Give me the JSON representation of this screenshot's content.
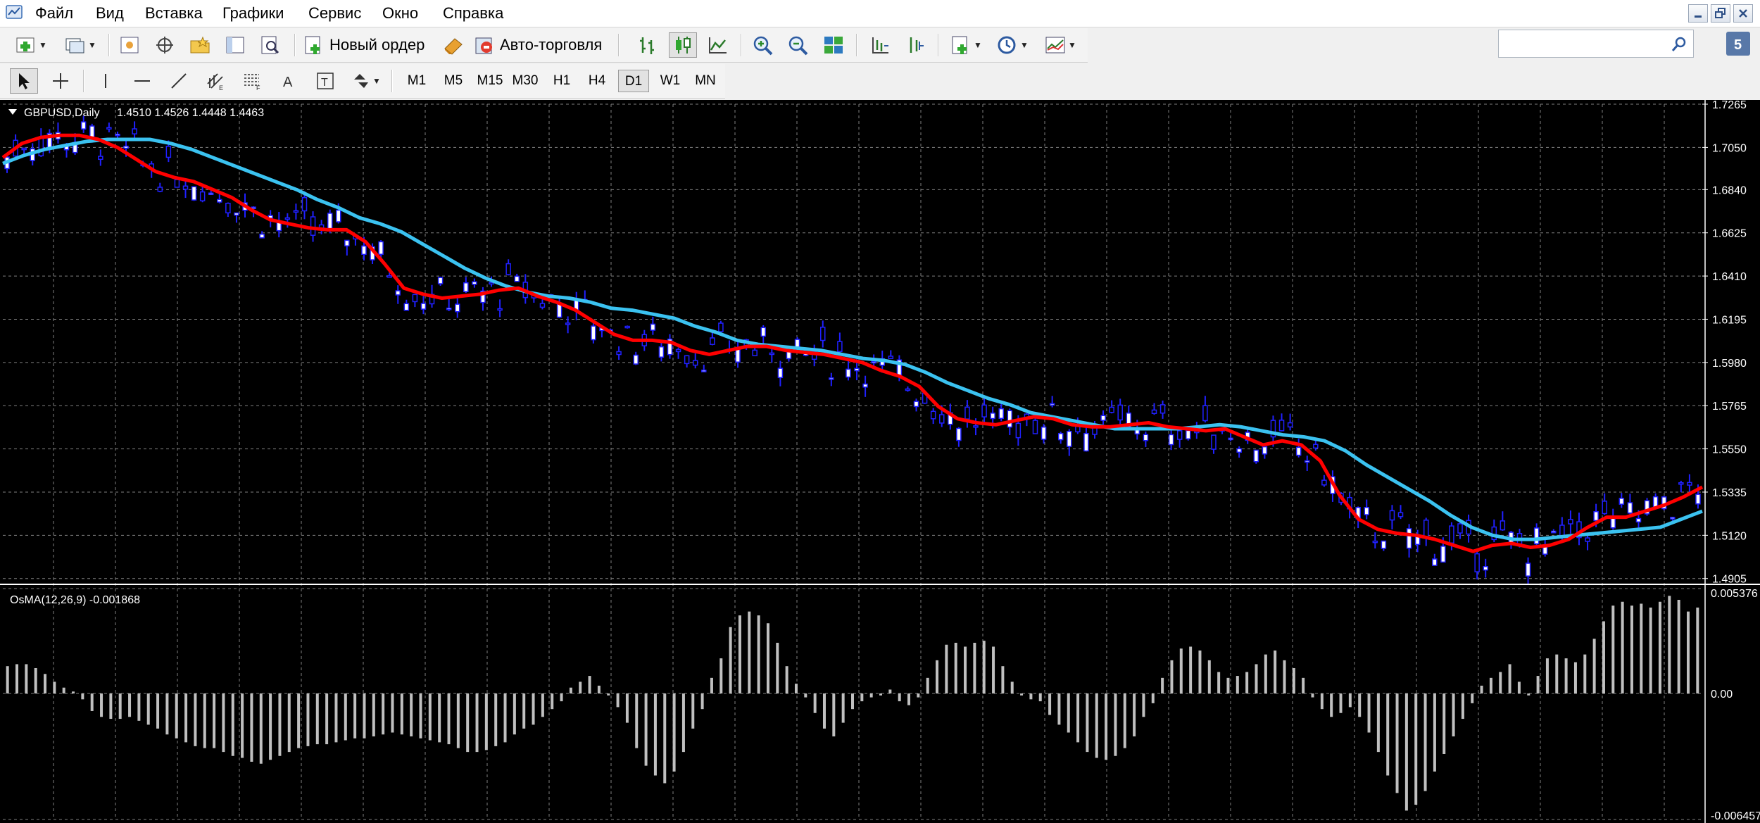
{
  "menu": [
    "Файл",
    "Вид",
    "Вставка",
    "Графики",
    "Сервис",
    "Окно",
    "Справка"
  ],
  "toolbar": {
    "new_order_label": "Новый ордер",
    "auto_trading_label": "Авто-торговля"
  },
  "timeframes": [
    "M1",
    "M5",
    "M15",
    "M30",
    "H1",
    "H4",
    "D1",
    "W1",
    "MN"
  ],
  "active_timeframe": "D1",
  "search": {
    "placeholder": "",
    "value": ""
  },
  "chart_data": [
    {
      "type": "line",
      "symbol": "GBPUSD,Daily",
      "ohlc_label": "1.4510 1.4526 1.4448 1.4463",
      "y_ticks": [
        "1.7265",
        "1.7050",
        "1.6840",
        "1.6625",
        "1.6410",
        "1.6195",
        "1.5980",
        "1.5765",
        "1.5550",
        "1.5335",
        "1.5120",
        "1.4905"
      ],
      "ylim": [
        1.489,
        1.7265
      ],
      "grid": true,
      "bars_shown": 200,
      "series": [
        {
          "color": "#ff0000",
          "values": [
            1.7,
            1.707,
            1.71,
            1.711,
            1.711,
            1.709,
            1.705,
            1.699,
            1.693,
            1.69,
            1.688,
            1.684,
            1.68,
            1.674,
            1.669,
            1.667,
            1.665,
            1.664,
            1.664,
            1.658,
            1.647,
            1.635,
            1.632,
            1.63,
            1.631,
            1.632,
            1.634,
            1.635,
            1.631,
            1.628,
            1.624,
            1.618,
            1.612,
            1.609,
            1.609,
            1.608,
            1.604,
            1.602,
            1.604,
            1.606,
            1.606,
            1.604,
            1.603,
            1.602,
            1.6,
            1.598,
            1.594,
            1.591,
            1.586,
            1.576,
            1.57,
            1.568,
            1.567,
            1.569,
            1.571,
            1.57,
            1.567,
            1.566,
            1.566,
            1.567,
            1.568,
            1.566,
            1.565,
            1.564,
            1.565,
            1.561,
            1.557,
            1.559,
            1.557,
            1.549,
            1.532,
            1.52,
            1.515,
            1.513,
            1.512,
            1.51,
            1.507,
            1.504,
            1.507,
            1.508,
            1.506,
            1.507,
            1.51,
            1.516,
            1.521,
            1.521,
            1.524,
            1.527,
            1.531,
            1.536
          ]
        },
        {
          "color": "#3bc2f0",
          "values": [
            1.697,
            1.701,
            1.704,
            1.706,
            1.708,
            1.709,
            1.709,
            1.709,
            1.707,
            1.704,
            1.7,
            1.696,
            1.692,
            1.688,
            1.684,
            1.679,
            1.675,
            1.67,
            1.667,
            1.663,
            1.657,
            1.651,
            1.645,
            1.64,
            1.636,
            1.633,
            1.631,
            1.63,
            1.628,
            1.625,
            1.624,
            1.622,
            1.62,
            1.616,
            1.613,
            1.609,
            1.607,
            1.606,
            1.605,
            1.604,
            1.602,
            1.6,
            1.599,
            1.597,
            1.593,
            1.588,
            1.584,
            1.58,
            1.577,
            1.573,
            1.571,
            1.569,
            1.567,
            1.565,
            1.565,
            1.565,
            1.565,
            1.566,
            1.567,
            1.566,
            1.564,
            1.562,
            1.561,
            1.559,
            1.554,
            1.547,
            1.541,
            1.535,
            1.529,
            1.522,
            1.516,
            1.512,
            1.51,
            1.51,
            1.511,
            1.512,
            1.513,
            1.514,
            1.515,
            1.516,
            1.52,
            1.524
          ]
        }
      ]
    },
    {
      "type": "bar",
      "title": "OsMA(12,26,9) -0.001868",
      "y_ticks": [
        "0.005376",
        "0.00",
        "-0.006457"
      ],
      "ylim": [
        -0.006457,
        0.005376
      ],
      "grid": true,
      "values": [
        0.0014,
        0.0015,
        0.0015,
        0.0013,
        0.001,
        0.0006,
        0.0003,
        0.0001,
        -0.0003,
        -0.0009,
        -0.0012,
        -0.0013,
        -0.0013,
        -0.0012,
        -0.0014,
        -0.0016,
        -0.0018,
        -0.0021,
        -0.0023,
        -0.0025,
        -0.0027,
        -0.0028,
        -0.0028,
        -0.003,
        -0.0032,
        -0.0033,
        -0.0035,
        -0.0036,
        -0.0034,
        -0.0032,
        -0.003,
        -0.0028,
        -0.0027,
        -0.0026,
        -0.0026,
        -0.0025,
        -0.0024,
        -0.0023,
        -0.0023,
        -0.0022,
        -0.0021,
        -0.002,
        -0.0021,
        -0.0022,
        -0.0023,
        -0.0024,
        -0.0025,
        -0.0026,
        -0.0028,
        -0.003,
        -0.003,
        -0.0029,
        -0.0027,
        -0.0025,
        -0.0021,
        -0.0018,
        -0.0016,
        -0.0012,
        -0.0008,
        -0.0004,
        0.0003,
        0.0006,
        0.0009,
        0.0004,
        -0.0001,
        -0.0007,
        -0.0015,
        -0.0028,
        -0.0037,
        -0.0042,
        -0.0046,
        -0.004,
        -0.003,
        -0.0018,
        -0.0008,
        0.0008,
        0.0018,
        0.0034,
        0.004,
        0.0042,
        0.004,
        0.0036,
        0.0026,
        0.0014,
        0.0005,
        -0.0002,
        -0.001,
        -0.0018,
        -0.0022,
        -0.0015,
        -0.0008,
        -0.0004,
        -0.0002,
        -0.0001,
        0.0002,
        -0.0004,
        -0.0006,
        -0.0002,
        0.0008,
        0.0017,
        0.0025,
        0.0026,
        0.0024,
        0.0026,
        0.0027,
        0.0024,
        0.0014,
        0.0006,
        -0.0001,
        -0.0003,
        -0.0004,
        -0.0011,
        -0.0016,
        -0.002,
        -0.0025,
        -0.003,
        -0.0033,
        -0.0034,
        -0.0032,
        -0.0028,
        -0.0022,
        -0.0012,
        -0.0005,
        0.0008,
        0.0017,
        0.0023,
        0.0024,
        0.0022,
        0.0017,
        0.0011,
        0.0008,
        0.0009,
        0.0011,
        0.0015,
        0.002,
        0.0022,
        0.0017,
        0.0013,
        0.0008,
        -0.0002,
        -0.0008,
        -0.0012,
        -0.001,
        -0.0007,
        -0.0012,
        -0.002,
        -0.003,
        -0.0042,
        -0.0051,
        -0.006,
        -0.0057,
        -0.005,
        -0.004,
        -0.0031,
        -0.0022,
        -0.0013,
        -0.0005,
        0.0004,
        0.0008,
        0.0011,
        0.0015,
        0.0006,
        -0.0001,
        0.0009,
        0.0018,
        0.002,
        0.0018,
        0.0016,
        0.002,
        0.0028,
        0.0037,
        0.0045,
        0.0047,
        0.0045,
        0.0046,
        0.0044,
        0.0047,
        0.005,
        0.0048,
        0.0042,
        0.0044
      ]
    }
  ]
}
